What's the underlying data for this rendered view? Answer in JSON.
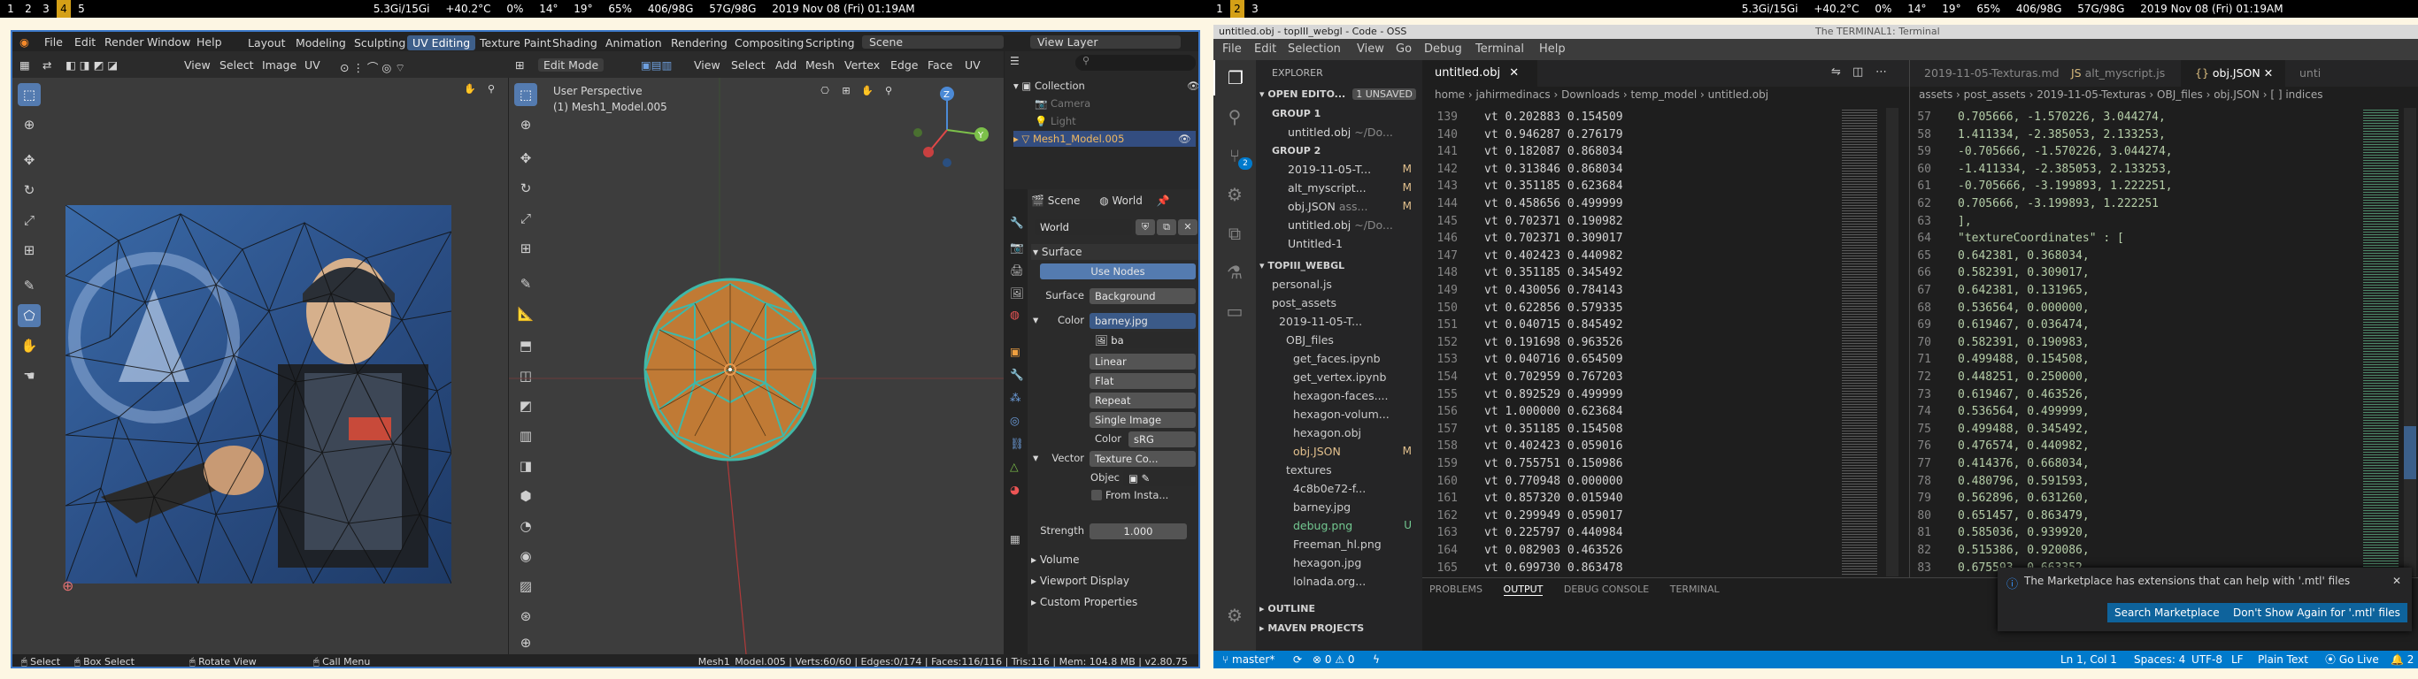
{
  "system_bar_left": {
    "workspaces": [
      "1",
      "2",
      "3",
      "4",
      "5"
    ],
    "stats": [
      "5.3Gi/15Gi",
      "+40.2°C",
      "0%",
      "14°",
      "19°",
      "65%",
      "406/98G",
      "57G/98G",
      "2019 Nov 08 (Fri) 01:19AM"
    ]
  },
  "system_bar_right": {
    "workspaces": [
      "1",
      "2",
      "3"
    ],
    "stats": [
      "5.3Gi/15Gi",
      "+40.2°C",
      "0%",
      "14°",
      "19°",
      "65%",
      "406/98G",
      "57G/98G",
      "2019 Nov 08 (Fri) 01:19AM"
    ]
  },
  "blender": {
    "menu": [
      "File",
      "Edit",
      "Render",
      "Window",
      "Help"
    ],
    "workspaces": [
      "Layout",
      "Modeling",
      "Sculpting",
      "UV Editing",
      "Texture Paint",
      "Shading",
      "Animation",
      "Rendering",
      "Compositing",
      "Scripting"
    ],
    "active_workspace": "UV Editing",
    "scene_label": "Scene",
    "view_layer_label": "View Layer",
    "uv_menu": [
      "View",
      "Select",
      "Image",
      "UV"
    ],
    "v3d_mode": "Edit Mode",
    "v3d_menu": [
      "View",
      "Select",
      "Add",
      "Mesh",
      "Vertex",
      "Edge",
      "Face",
      "UV"
    ],
    "viewport_title": "User Perspective",
    "viewport_object": "(1) Mesh1_Model.005",
    "outliner": {
      "collection": "Collection",
      "items": [
        "Camera",
        "Light",
        "Mesh1_Model.005"
      ]
    },
    "props": {
      "tabs": [
        "Scene",
        "World"
      ],
      "world_name": "World",
      "surface": "Surface",
      "use_nodes": "Use Nodes",
      "surface_label": "Surface",
      "surface_val": "Background",
      "color_label": "Color",
      "color_val": "barney.jpg",
      "image_name": "ba",
      "interp": "Linear",
      "proj": "Flat",
      "ext": "Repeat",
      "source": "Single Image",
      "cs_label": "Color",
      "cs_val": "sRG",
      "vector_label": "Vector",
      "vector_val": "Texture Co...",
      "object_label": "Objec",
      "from_inst": "From Insta...",
      "strength_label": "Strength",
      "strength_val": "1.000",
      "sections": [
        "Volume",
        "Viewport Display",
        "Custom Properties"
      ]
    },
    "status_left": [
      "Select",
      "Box Select",
      "Rotate View",
      "Call Menu"
    ],
    "status_right": "Mesh1_Model.005 | Verts:60/60 | Edges:0/174 | Faces:116/116 | Tris:116 | Mem: 104.8 MB | v2.80.75"
  },
  "vscode": {
    "title": "untitled.obj - topIII_webgl - Code - OSS",
    "terminal_tabs": [
      "The TERMINAL",
      "1: Terminal"
    ],
    "menu": [
      "File",
      "Edit",
      "Selection",
      "View",
      "Go",
      "Debug",
      "Terminal",
      "Help"
    ],
    "explorer_label": "EXPLORER",
    "open_editors": "OPEN EDITO...",
    "unsaved": "1 UNSAVED",
    "open_items": [
      {
        "t": "GROUP 1",
        "k": "group"
      },
      {
        "t": "untitled.obj",
        "d": "~/Do...",
        "k": "file"
      },
      {
        "t": "GROUP 2",
        "k": "group"
      },
      {
        "t": "2019-11-05-T...",
        "b": "M",
        "k": "file"
      },
      {
        "t": "alt_myscript...",
        "b": "M",
        "k": "file"
      },
      {
        "t": "obj.JSON",
        "d": "ass...",
        "b": "M",
        "k": "file"
      },
      {
        "t": "untitled.obj",
        "d": "~/Do...",
        "k": "file"
      },
      {
        "t": "Untitled-1",
        "k": "file"
      }
    ],
    "workspace_label": "TOPIII_WEBGL",
    "tree": [
      {
        "t": "personal.js",
        "i": 1
      },
      {
        "t": "post_assets",
        "i": 1
      },
      {
        "t": "2019-11-05-T...",
        "i": 2
      },
      {
        "t": "OBJ_files",
        "i": 3
      },
      {
        "t": "get_faces.ipynb",
        "i": 4
      },
      {
        "t": "get_vertex.ipynb",
        "i": 4
      },
      {
        "t": "hexagon-faces....",
        "i": 4
      },
      {
        "t": "hexagon-volum...",
        "i": 4
      },
      {
        "t": "hexagon.obj",
        "i": 4
      },
      {
        "t": "obj.JSON",
        "i": 4,
        "b": "M"
      },
      {
        "t": "textures",
        "i": 3
      },
      {
        "t": "4c8b0e72-f...",
        "i": 4
      },
      {
        "t": "barney.jpg",
        "i": 4
      },
      {
        "t": "debug.png",
        "i": 4,
        "b": "U"
      },
      {
        "t": "Freeman_hl.png",
        "i": 4
      },
      {
        "t": "hexagon.jpg",
        "i": 4
      },
      {
        "t": "lolnada.org...",
        "i": 4
      }
    ],
    "outline_label": "OUTLINE",
    "maven_label": "MAVEN PROJECTS",
    "editor1": {
      "tab": "untitled.obj",
      "breadcrumb": [
        "home",
        "jahirmedinacs",
        "Downloads",
        "temp_model",
        "untitled.obj"
      ],
      "lines": [
        [
          "139",
          "vt 0.202883 0.154509"
        ],
        [
          "140",
          "vt 0.946287 0.276179"
        ],
        [
          "141",
          "vt 0.182087 0.868034"
        ],
        [
          "142",
          "vt 0.313846 0.868034"
        ],
        [
          "143",
          "vt 0.351185 0.623684"
        ],
        [
          "144",
          "vt 0.458656 0.499999"
        ],
        [
          "145",
          "vt 0.702371 0.190982"
        ],
        [
          "146",
          "vt 0.702371 0.309017"
        ],
        [
          "147",
          "vt 0.402423 0.440982"
        ],
        [
          "148",
          "vt 0.351185 0.345492"
        ],
        [
          "149",
          "vt 0.430056 0.784143"
        ],
        [
          "150",
          "vt 0.622856 0.579335"
        ],
        [
          "151",
          "vt 0.040715 0.845492"
        ],
        [
          "152",
          "vt 0.191698 0.963526"
        ],
        [
          "153",
          "vt 0.040716 0.654509"
        ],
        [
          "154",
          "vt 0.702959 0.767203"
        ],
        [
          "155",
          "vt 0.892529 0.499999"
        ],
        [
          "156",
          "vt 1.000000 0.623684"
        ],
        [
          "157",
          "vt 0.351185 0.154508"
        ],
        [
          "158",
          "vt 0.402423 0.059016"
        ],
        [
          "159",
          "vt 0.755751 0.150986"
        ],
        [
          "160",
          "vt 0.770948 0.000000"
        ],
        [
          "161",
          "vt 0.857320 0.015940"
        ],
        [
          "162",
          "vt 0.299949 0.059017"
        ],
        [
          "163",
          "vt 0.225797 0.440984"
        ],
        [
          "164",
          "vt 0.082903 0.463526"
        ],
        [
          "165",
          "vt 0.699730 0.863478"
        ]
      ]
    },
    "editor2": {
      "tabs": [
        "2019-11-05-Texturas.md",
        "alt_myscript.js",
        "obj.JSON",
        "unti"
      ],
      "breadcrumb": [
        "assets",
        "post_assets",
        "2019-11-05-Texturas",
        "OBJ_files",
        "obj.JSON",
        "[ ] indices"
      ],
      "lines": [
        [
          "57",
          "0.705666, -1.570226, 3.044274,"
        ],
        [
          "58",
          "1.411334, -2.385053, 2.133253,"
        ],
        [
          "59",
          "-0.705666, -1.570226, 3.044274,"
        ],
        [
          "60",
          "-1.411334, -2.385053, 2.133253,"
        ],
        [
          "61",
          "-0.705666, -3.199893, 1.222251,"
        ],
        [
          "62",
          "0.705666, -3.199893, 1.222251"
        ],
        [
          "63",
          "],"
        ],
        [
          "64",
          "\"textureCoordinates\" : ["
        ],
        [
          "65",
          "0.642381, 0.368034,"
        ],
        [
          "66",
          "0.582391, 0.309017,"
        ],
        [
          "67",
          "0.642381, 0.131965,"
        ],
        [
          "68",
          "0.536564, 0.000000,"
        ],
        [
          "69",
          "0.619467, 0.036474,"
        ],
        [
          "70",
          "0.582391, 0.190983,"
        ],
        [
          "71",
          "0.499488, 0.154508,"
        ],
        [
          "72",
          "0.448251, 0.250000,"
        ],
        [
          "73",
          "0.619467, 0.463526,"
        ],
        [
          "74",
          "0.536564, 0.499999,"
        ],
        [
          "75",
          "0.499488, 0.345492,"
        ],
        [
          "76",
          "0.476574, 0.440982,"
        ],
        [
          "77",
          "0.414376, 0.668034,"
        ],
        [
          "78",
          "0.480796, 0.591593,"
        ],
        [
          "79",
          "0.562896, 0.631260,"
        ],
        [
          "80",
          "0.651457, 0.863479,"
        ],
        [
          "81",
          "0.585036, 0.939920,"
        ],
        [
          "82",
          "0.515386, 0.920086,"
        ],
        [
          "83",
          "0.675593, 0.663352,"
        ]
      ]
    },
    "panel_tabs": [
      "PROBLEMS",
      "OUTPUT",
      "DEBUG CONSOLE",
      "TERMINAL"
    ],
    "active_panel": "OUTPUT",
    "notification": {
      "text": "The Marketplace has extensions that can help with '.mtl' files",
      "btn1": "Search Marketplace",
      "btn2": "Don't Show Again for '.mtl' files"
    },
    "status": {
      "branch": "master*",
      "errors": "0",
      "warnings": "0",
      "position": "Ln 1, Col 1",
      "spaces": "Spaces: 4",
      "encoding": "UTF-8",
      "eol": "LF",
      "lang": "Plain Text",
      "live": "Go Live",
      "notif_count": "2"
    }
  },
  "colors": {
    "blender_accent": "#547bb0",
    "vscode_blue": "#007acc",
    "mesh_orange": "#c07a35",
    "mesh_edge": "#3fb8a8"
  }
}
